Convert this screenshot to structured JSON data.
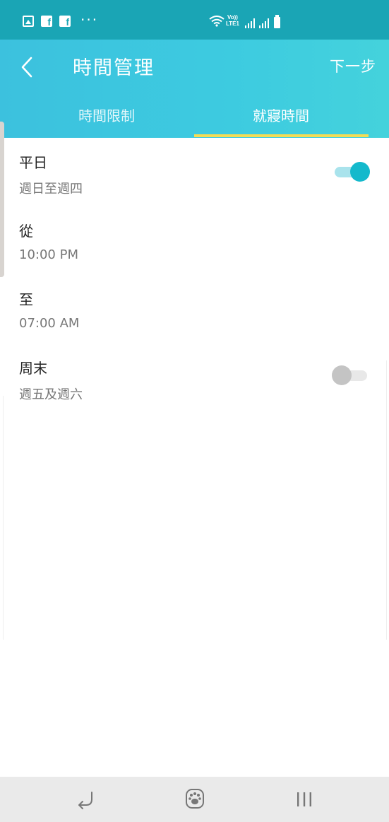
{
  "status_bar": {
    "icons": [
      "gallery-icon",
      "facebook-icon",
      "facebook-icon",
      "more-dots-icon",
      "wifi-icon",
      "volte-icon",
      "signal-icon",
      "signal-icon",
      "battery-icon"
    ],
    "dots": "···",
    "volte_top": "Vo))",
    "volte_bottom": "LTE1"
  },
  "app_bar": {
    "title": "時間管理",
    "next_label": "下一步"
  },
  "tabs": [
    {
      "label": "時間限制",
      "selected": false
    },
    {
      "label": "就寢時間",
      "selected": true
    }
  ],
  "settings": {
    "weekday": {
      "title": "平日",
      "subtitle": "週日至週四",
      "enabled": true
    },
    "from": {
      "title": "從",
      "value": "10:00 PM"
    },
    "to": {
      "title": "至",
      "value": "07:00 AM"
    },
    "weekend": {
      "title": "周末",
      "subtitle": "週五及週六",
      "enabled": false
    }
  },
  "colors": {
    "status_bar": "#1aa5b5",
    "app_bar": "#3dc6df",
    "tab_indicator": "#f3dc55",
    "toggle_on": "#14b9cc",
    "toggle_off": "#c4c4c4"
  },
  "nav_bar": {
    "icons": [
      "back-arrow-icon",
      "paw-home-icon",
      "recent-apps-icon"
    ]
  }
}
